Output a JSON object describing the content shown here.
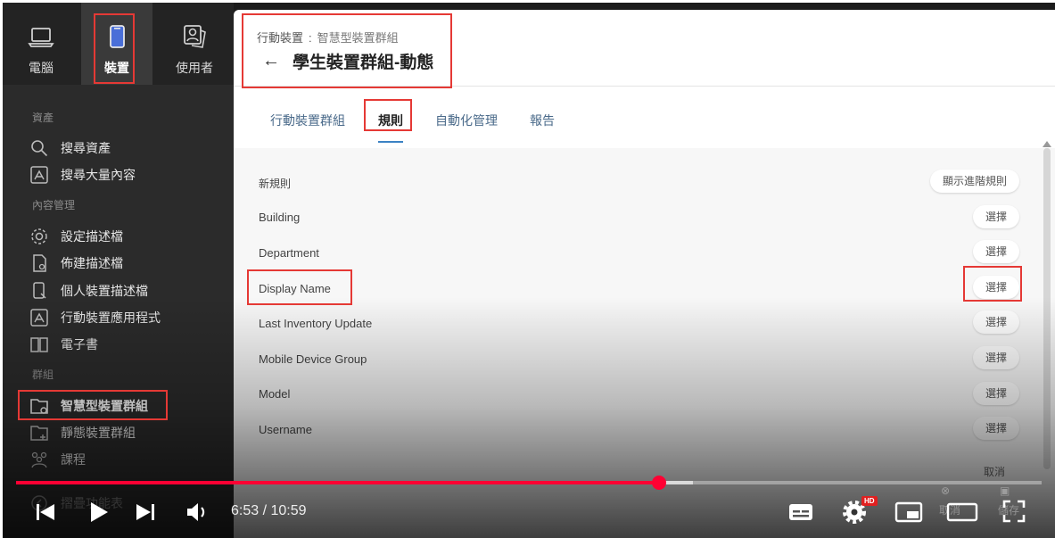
{
  "sidebar": {
    "topnav": [
      {
        "label": "電腦",
        "icon": "laptop-icon"
      },
      {
        "label": "裝置",
        "icon": "mobile-device-icon"
      },
      {
        "label": "使用者",
        "icon": "users-icon"
      }
    ],
    "sections": {
      "assets": "資產",
      "content": "內容管理",
      "groups": "群組"
    },
    "items": [
      {
        "label": "搜尋資產",
        "icon": "search-icon"
      },
      {
        "label": "搜尋大量內容",
        "icon": "app-search-icon"
      },
      {
        "label": "設定描述檔",
        "icon": "gear-icon"
      },
      {
        "label": "佈建描述檔",
        "icon": "document-icon"
      },
      {
        "label": "個人裝置描述檔",
        "icon": "personal-device-icon"
      },
      {
        "label": "行動裝置應用程式",
        "icon": "app-store-icon"
      },
      {
        "label": "電子書",
        "icon": "book-icon"
      },
      {
        "label": "智慧型裝置群組",
        "icon": "smart-folder-icon"
      },
      {
        "label": "靜態裝置群組",
        "icon": "static-folder-icon"
      },
      {
        "label": "課程",
        "icon": "class-icon"
      }
    ],
    "collapse_label": "摺疊功能表"
  },
  "header": {
    "breadcrumb_parent": "行動裝置",
    "breadcrumb_sep": ":",
    "breadcrumb_current": "智慧型裝置群組",
    "title": "學生裝置群組-動態"
  },
  "tabs": [
    {
      "label": "行動裝置群組"
    },
    {
      "label": "規則"
    },
    {
      "label": "自動化管理"
    },
    {
      "label": "報告"
    }
  ],
  "rules": {
    "new_rule_label": "新規則",
    "advanced_button": "顯示進階規則",
    "criteria": [
      {
        "label": "Building",
        "button": "選擇"
      },
      {
        "label": "Department",
        "button": "選擇"
      },
      {
        "label": "Display Name",
        "button": "選擇"
      },
      {
        "label": "Last Inventory Update",
        "button": "選擇"
      },
      {
        "label": "Mobile Device Group",
        "button": "選擇"
      },
      {
        "label": "Model",
        "button": "選擇"
      },
      {
        "label": "Username",
        "button": "選擇"
      }
    ],
    "cancel_label": "取消"
  },
  "footer_ghost": {
    "cancel": "取消",
    "save": "儲存"
  },
  "player": {
    "time": "6:53 / 10:59",
    "progress": 0.627,
    "buffered": 0.66,
    "hd_badge": "HD"
  },
  "colors": {
    "accent_red": "#e53935",
    "progress_red": "#ff0033",
    "tab_blue": "#3b82c4"
  }
}
